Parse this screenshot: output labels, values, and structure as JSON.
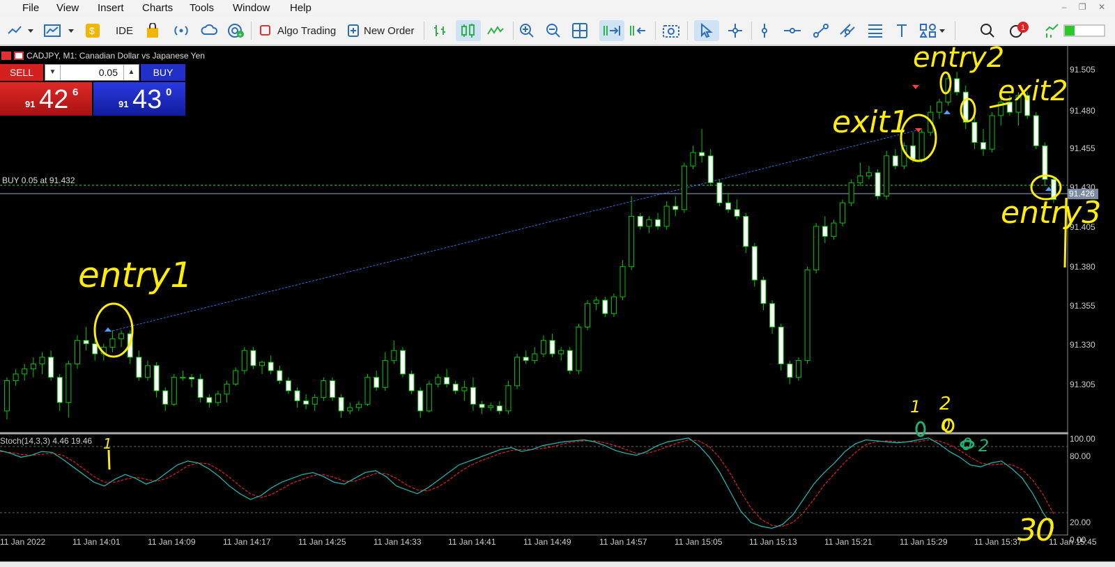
{
  "menu": [
    "File",
    "View",
    "Insert",
    "Charts",
    "Tools",
    "Window",
    "Help"
  ],
  "toolbar": {
    "ide": "IDE",
    "algo_trading": "Algo Trading",
    "new_order": "New Order",
    "notifications": "1"
  },
  "chart": {
    "title": "CADJPY, M1:  Canadian Dollar vs Japanese Yen",
    "buy_line_label": "BUY 0.05 at 91.432",
    "current_price": "91.426",
    "price_ticks": [
      "91.505",
      "91.480",
      "91.455",
      "91.430",
      "91.405",
      "91.380",
      "91.355",
      "91.330",
      "91.305"
    ],
    "time_ticks": [
      "11 Jan 2022",
      "11 Jan 14:01",
      "11 Jan 14:09",
      "11 Jan 14:17",
      "11 Jan 14:25",
      "11 Jan 14:33",
      "11 Jan 14:41",
      "11 Jan 14:49",
      "11 Jan 14:57",
      "11 Jan 15:05",
      "11 Jan 15:13",
      "11 Jan 15:21",
      "11 Jan 15:29",
      "11 Jan 15:37",
      "11 Jan 15:45"
    ]
  },
  "trade_panel": {
    "sell_label": "SELL",
    "buy_label": "BUY",
    "lot": "0.05",
    "sell_big": "91",
    "sell_main": "42",
    "sell_sup": "6",
    "buy_big": "91",
    "buy_main": "43",
    "buy_sup": "0"
  },
  "stoch": {
    "label": "Stoch(14,3,3) 4.46 19.46",
    "ticks": [
      "100.00",
      "80.00",
      "20.00",
      "0.00"
    ]
  },
  "annotations": [
    "entry1",
    "exit1",
    "entry2",
    "exit2",
    "entry3",
    "1",
    "1",
    "2",
    "0",
    "0",
    "2",
    "3",
    "0"
  ],
  "colors": {
    "bull": "#00c800",
    "bear": "#ffffff",
    "stoch_main": "#20b2aa",
    "stoch_signal": "#e02020",
    "annotation": "#ffee00"
  },
  "chart_data": {
    "type": "candlestick",
    "series": [
      {
        "name": "CADJPY M1",
        "ohlc": [
          [
            91.3,
            91.32,
            91.295,
            91.318
          ],
          [
            91.318,
            91.325,
            91.315,
            91.322
          ],
          [
            91.322,
            91.328,
            91.318,
            91.325
          ],
          [
            91.325,
            91.332,
            91.32,
            91.328
          ],
          [
            91.328,
            91.335,
            91.322,
            91.332
          ],
          [
            91.332,
            91.336,
            91.318,
            91.32
          ],
          [
            91.32,
            91.322,
            91.3,
            91.305
          ],
          [
            91.305,
            91.33,
            91.296,
            91.328
          ],
          [
            91.328,
            91.345,
            91.325,
            91.342
          ],
          [
            91.342,
            91.35,
            91.336,
            91.34
          ],
          [
            91.34,
            91.342,
            91.33,
            91.334
          ],
          [
            91.334,
            91.34,
            91.33,
            91.338
          ],
          [
            91.338,
            91.348,
            91.335,
            91.343
          ],
          [
            91.343,
            91.348,
            91.338,
            91.346
          ],
          [
            91.346,
            91.348,
            91.328,
            91.332
          ],
          [
            91.332,
            91.336,
            91.318,
            91.32
          ],
          [
            91.32,
            91.33,
            91.318,
            91.327
          ],
          [
            91.327,
            91.329,
            91.308,
            91.312
          ],
          [
            91.312,
            91.314,
            91.3,
            91.304
          ],
          [
            91.304,
            91.322,
            91.303,
            91.32
          ],
          [
            91.32,
            91.324,
            91.318,
            91.32
          ],
          [
            91.32,
            91.322,
            91.314,
            91.319
          ],
          [
            91.319,
            91.322,
            91.305,
            91.308
          ],
          [
            91.308,
            91.31,
            91.302,
            91.305
          ],
          [
            91.305,
            91.312,
            91.303,
            91.31
          ],
          [
            91.31,
            91.318,
            91.305,
            91.316
          ],
          [
            91.316,
            91.326,
            91.315,
            91.324
          ],
          [
            91.324,
            91.338,
            91.322,
            91.336
          ],
          [
            91.336,
            91.338,
            91.325,
            91.327
          ],
          [
            91.327,
            91.33,
            91.322,
            91.329
          ],
          [
            91.329,
            91.333,
            91.322,
            91.324
          ],
          [
            91.324,
            91.327,
            91.316,
            91.318
          ],
          [
            91.318,
            91.32,
            91.31,
            91.312
          ],
          [
            91.312,
            91.314,
            91.302,
            91.306
          ],
          [
            91.306,
            91.31,
            91.301,
            91.304
          ],
          [
            91.304,
            91.31,
            91.3,
            91.308
          ],
          [
            91.308,
            91.32,
            91.306,
            91.318
          ],
          [
            91.318,
            91.32,
            91.306,
            91.308
          ],
          [
            91.308,
            91.31,
            91.296,
            91.3
          ],
          [
            91.3,
            91.305,
            91.298,
            91.302
          ],
          [
            91.302,
            91.306,
            91.3,
            91.304
          ],
          [
            91.304,
            91.322,
            91.303,
            91.32
          ],
          [
            91.32,
            91.324,
            91.312,
            91.314
          ],
          [
            91.314,
            91.335,
            91.312,
            91.33
          ],
          [
            91.33,
            91.342,
            91.328,
            91.336
          ],
          [
            91.336,
            91.338,
            91.32,
            91.322
          ],
          [
            91.322,
            91.324,
            91.31,
            91.312
          ],
          [
            91.312,
            91.314,
            91.296,
            91.3
          ],
          [
            91.3,
            91.318,
            91.299,
            91.316
          ],
          [
            91.316,
            91.322,
            91.314,
            91.32
          ],
          [
            91.32,
            91.325,
            91.314,
            91.316
          ],
          [
            91.316,
            91.318,
            91.31,
            91.312
          ],
          [
            91.312,
            91.318,
            91.306,
            91.314
          ],
          [
            91.314,
            91.32,
            91.3,
            91.304
          ],
          [
            91.304,
            91.306,
            91.298,
            91.302
          ],
          [
            91.302,
            91.305,
            91.3,
            91.303
          ],
          [
            91.303,
            91.306,
            91.298,
            91.3
          ],
          [
            91.3,
            91.318,
            91.298,
            91.315
          ],
          [
            91.315,
            91.334,
            91.313,
            91.332
          ],
          [
            91.332,
            91.336,
            91.328,
            91.33
          ],
          [
            91.33,
            91.338,
            91.328,
            91.334
          ],
          [
            91.334,
            91.345,
            91.332,
            91.342
          ],
          [
            91.342,
            91.346,
            91.332,
            91.334
          ],
          [
            91.334,
            91.338,
            91.33,
            91.336
          ],
          [
            91.336,
            91.338,
            91.322,
            91.324
          ],
          [
            91.324,
            91.352,
            91.322,
            91.35
          ],
          [
            91.35,
            91.366,
            91.348,
            91.364
          ],
          [
            91.364,
            91.368,
            91.36,
            91.366
          ],
          [
            91.366,
            91.368,
            91.356,
            91.358
          ],
          [
            91.358,
            91.37,
            91.356,
            91.368
          ],
          [
            91.368,
            91.39,
            91.366,
            91.386
          ],
          [
            91.386,
            91.428,
            91.384,
            91.416
          ],
          [
            91.416,
            91.418,
            91.408,
            91.41
          ],
          [
            91.41,
            91.416,
            91.406,
            91.414
          ],
          [
            91.414,
            91.418,
            91.408,
            91.41
          ],
          [
            91.41,
            91.425,
            91.408,
            91.422
          ],
          [
            91.422,
            91.428,
            91.416,
            91.42
          ],
          [
            91.42,
            91.448,
            91.418,
            91.446
          ],
          [
            91.446,
            91.458,
            91.444,
            91.454
          ],
          [
            91.454,
            91.468,
            91.448,
            91.452
          ],
          [
            91.452,
            91.456,
            91.434,
            91.436
          ],
          [
            91.436,
            91.438,
            91.422,
            91.424
          ],
          [
            91.424,
            91.43,
            91.418,
            91.42
          ],
          [
            91.42,
            91.426,
            91.414,
            91.416
          ],
          [
            91.416,
            91.418,
            91.394,
            91.398
          ],
          [
            91.398,
            91.4,
            91.374,
            91.378
          ],
          [
            91.378,
            91.38,
            91.36,
            91.364
          ],
          [
            91.364,
            91.366,
            91.346,
            91.35
          ],
          [
            91.35,
            91.352,
            91.324,
            91.328
          ],
          [
            91.328,
            91.33,
            91.316,
            91.32
          ],
          [
            91.32,
            91.332,
            91.318,
            91.33
          ],
          [
            91.33,
            91.386,
            91.328,
            91.384
          ],
          [
            91.384,
            91.412,
            91.382,
            91.41
          ],
          [
            91.41,
            91.416,
            91.4,
            91.404
          ],
          [
            91.404,
            91.414,
            91.402,
            91.412
          ],
          [
            91.412,
            91.426,
            91.41,
            91.424
          ],
          [
            91.424,
            91.438,
            91.422,
            91.436
          ],
          [
            91.436,
            91.448,
            91.434,
            91.44
          ],
          [
            91.44,
            91.446,
            91.438,
            91.442
          ],
          [
            91.442,
            91.444,
            91.426,
            91.428
          ],
          [
            91.428,
            91.455,
            91.426,
            91.452
          ],
          [
            91.452,
            91.456,
            91.444,
            91.446
          ],
          [
            91.446,
            91.46,
            91.444,
            91.458
          ],
          [
            91.458,
            91.466,
            91.448,
            91.45
          ],
          [
            91.45,
            91.468,
            91.448,
            91.466
          ],
          [
            91.466,
            91.482,
            91.464,
            91.478
          ],
          [
            91.478,
            91.486,
            91.474,
            91.484
          ],
          [
            91.484,
            91.5,
            91.482,
            91.498
          ],
          [
            91.498,
            91.502,
            91.488,
            91.49
          ],
          [
            91.49,
            91.494,
            91.468,
            91.472
          ],
          [
            91.472,
            91.478,
            91.456,
            91.46
          ],
          [
            91.46,
            91.468,
            91.452,
            91.456
          ],
          [
            91.456,
            91.478,
            91.454,
            91.476
          ],
          [
            91.476,
            91.49,
            91.47,
            91.484
          ],
          [
            91.484,
            91.488,
            91.476,
            91.478
          ],
          [
            91.478,
            91.49,
            91.47,
            91.488
          ],
          [
            91.488,
            91.49,
            91.474,
            91.476
          ],
          [
            91.476,
            91.478,
            91.456,
            91.458
          ],
          [
            91.458,
            91.46,
            91.434,
            91.438
          ],
          [
            91.438,
            91.44,
            91.424,
            91.426
          ]
        ]
      },
      {
        "name": "Stoch main",
        "values": [
          85,
          82,
          78,
          80,
          84,
          83,
          76,
          68,
          60,
          52,
          48,
          55,
          60,
          56,
          50,
          54,
          62,
          70,
          74,
          72,
          66,
          58,
          48,
          40,
          34,
          38,
          46,
          52,
          56,
          60,
          62,
          58,
          52,
          50,
          56,
          62,
          64,
          58,
          48,
          44,
          40,
          46,
          54,
          62,
          70,
          74,
          78,
          82,
          86,
          88,
          84,
          86,
          90,
          92,
          94,
          95,
          96,
          94,
          90,
          85,
          82,
          80,
          84,
          90,
          94,
          96,
          98,
          90,
          78,
          62,
          42,
          22,
          10,
          6,
          4,
          8,
          18,
          34,
          50,
          62,
          72,
          84,
          92,
          96,
          95,
          94,
          93,
          94,
          96,
          98,
          92,
          84,
          78,
          70,
          68,
          72,
          74,
          66,
          56,
          40,
          20,
          4
        ]
      },
      {
        "name": "Stoch signal",
        "values": [
          84,
          83,
          81,
          80,
          81,
          82,
          80,
          74,
          66,
          58,
          52,
          52,
          55,
          57,
          55,
          53,
          56,
          62,
          69,
          72,
          71,
          65,
          57,
          48,
          40,
          36,
          39,
          45,
          51,
          55,
          59,
          60,
          57,
          53,
          53,
          57,
          61,
          61,
          56,
          49,
          44,
          43,
          47,
          54,
          62,
          69,
          74,
          78,
          82,
          85,
          86,
          86,
          87,
          89,
          92,
          94,
          95,
          95,
          93,
          90,
          86,
          82,
          82,
          85,
          89,
          93,
          96,
          95,
          89,
          77,
          61,
          42,
          25,
          13,
          7,
          6,
          10,
          20,
          34,
          49,
          61,
          73,
          83,
          91,
          94,
          95,
          94,
          94,
          94,
          96,
          95,
          91,
          85,
          78,
          72,
          70,
          71,
          70,
          65,
          54,
          39,
          19
        ]
      }
    ]
  }
}
